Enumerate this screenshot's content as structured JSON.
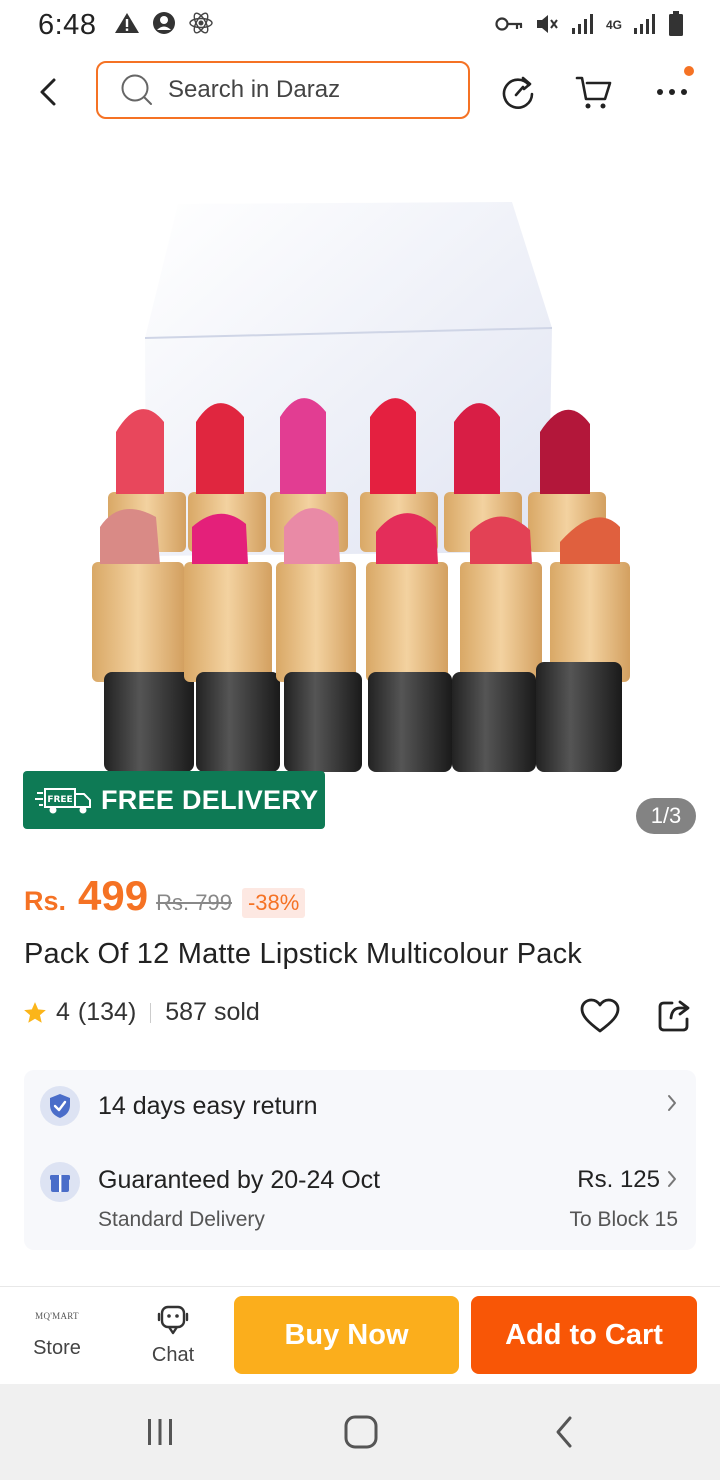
{
  "status_bar": {
    "time": "6:48",
    "network": "4G",
    "icons": [
      "warning-icon",
      "account-icon",
      "react-icon",
      "vpn-key-icon",
      "mute-icon",
      "signal-icon",
      "battery-icon"
    ]
  },
  "header": {
    "search_placeholder": "Search in Daraz",
    "icons": [
      "back-icon",
      "search-icon",
      "share-arrow-icon",
      "cart-icon",
      "more-icon"
    ],
    "accent_color": "#f57224"
  },
  "gallery": {
    "badge_text": "FREE DELIVERY",
    "badge_icon_text": "FREE",
    "badge_color": "#0e7a55",
    "page_indicator": "1/3"
  },
  "product": {
    "currency": "Rs.",
    "price": "499",
    "original_price": "Rs. 799",
    "discount": "-38%",
    "title": "Pack Of 12 Matte Lipstick Multicolour Pack",
    "rating": "4",
    "reviews": "(134)",
    "sold": "587 sold"
  },
  "delivery": {
    "return_text": "14 days easy return",
    "guarantee_text": "Guaranteed by 20-24 Oct",
    "delivery_type": "Standard Delivery",
    "delivery_fee": "Rs. 125",
    "delivery_location": "To Block 15"
  },
  "bottom_bar": {
    "store_logo": "MQ'MART",
    "store_label": "Store",
    "chat_label": "Chat",
    "buy_now_label": "Buy Now",
    "add_to_cart_label": "Add to Cart",
    "buy_color": "#fbae1c",
    "cart_color": "#f85606"
  }
}
